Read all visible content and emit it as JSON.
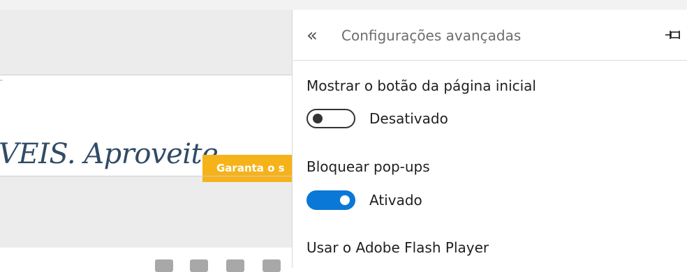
{
  "background_page": {
    "promo_text": "VEIS. Aproveite.",
    "promo_button_label": "Garanta o s",
    "tick_mark": "-",
    "social_icons": [
      "facebook-icon",
      "twitter-icon",
      "youtube-icon",
      "instagram-icon"
    ]
  },
  "panel": {
    "back_icon": "«",
    "title": "Configurações avançadas",
    "pin_icon": "pin-icon",
    "settings": [
      {
        "label": "Mostrar o botão da página inicial",
        "state_label": "Desativado",
        "enabled": false
      },
      {
        "label": "Bloquear pop-ups",
        "state_label": "Ativado",
        "enabled": true
      },
      {
        "label": "Usar o Adobe Flash Player"
      }
    ]
  },
  "colors": {
    "toggle_on": "#0a78d7",
    "promo_button": "#f6b219",
    "promo_text": "#2f4b66"
  }
}
